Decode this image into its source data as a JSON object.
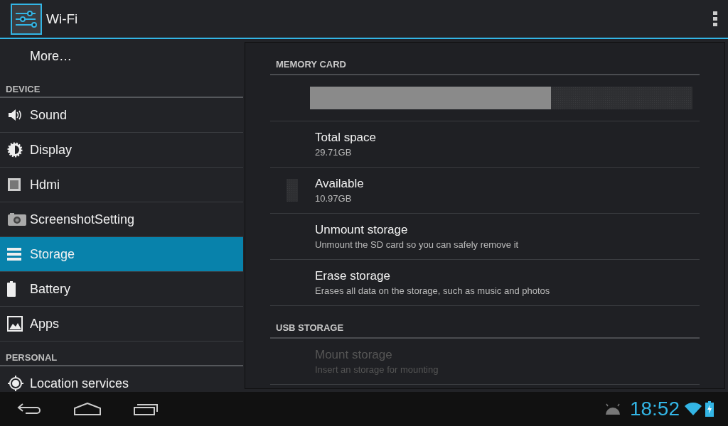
{
  "action_bar": {
    "title": "Wi-Fi"
  },
  "sidebar": {
    "items": [
      {
        "kind": "item",
        "label": "More…",
        "selected": false
      },
      {
        "kind": "header",
        "label": "DEVICE"
      },
      {
        "kind": "item",
        "label": "Sound",
        "selected": false
      },
      {
        "kind": "item",
        "label": "Display",
        "selected": false
      },
      {
        "kind": "item",
        "label": "Hdmi",
        "selected": false
      },
      {
        "kind": "item",
        "label": "ScreenshotSetting",
        "selected": false
      },
      {
        "kind": "item",
        "label": "Storage",
        "selected": true
      },
      {
        "kind": "item",
        "label": "Battery",
        "selected": false
      },
      {
        "kind": "item",
        "label": "Apps",
        "selected": false
      },
      {
        "kind": "header",
        "label": "PERSONAL"
      },
      {
        "kind": "item",
        "label": "Location services",
        "selected": false
      }
    ]
  },
  "storage": {
    "sections": [
      {
        "title": "MEMORY CARD",
        "rows": [
          {
            "kind": "meter",
            "level": 0.63
          },
          {
            "kind": "info",
            "title": "Total space",
            "summary": "29.71GB",
            "disabled": false
          },
          {
            "kind": "legend",
            "title": "Available",
            "summary": "10.97GB",
            "disabled": false
          },
          {
            "kind": "info",
            "title": "Unmount storage",
            "summary": "Unmount the SD card so you can safely remove it",
            "disabled": false
          },
          {
            "kind": "info",
            "title": "Erase storage",
            "summary": "Erases all data on the storage, such as music and photos",
            "disabled": false
          }
        ]
      },
      {
        "title": "USB STORAGE",
        "rows": [
          {
            "kind": "info",
            "title": "Mount storage",
            "summary": "Insert an storage for mounting",
            "disabled": true
          }
        ]
      }
    ]
  },
  "system_bar": {
    "time": "18:52"
  }
}
